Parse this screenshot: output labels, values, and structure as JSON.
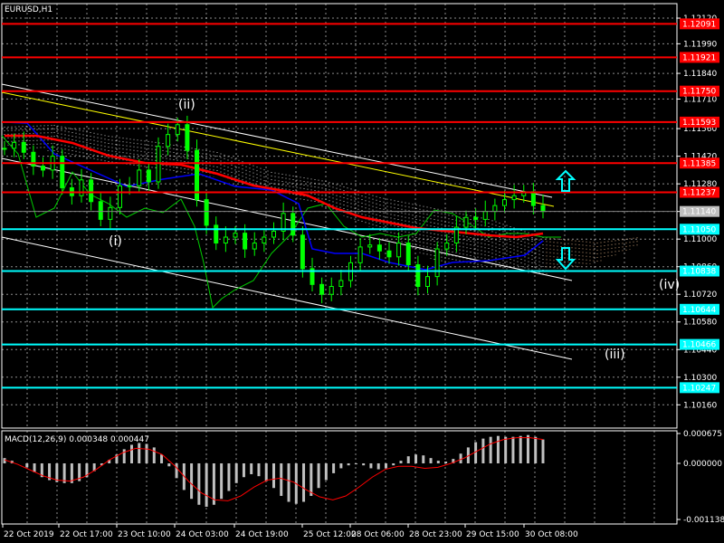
{
  "chart_data": {
    "type": "candlestick",
    "title": "EURUSD,H1",
    "colors": {
      "background": "#000000",
      "grid": "#ffffff",
      "candle": "#00ff00",
      "resistance": "#ff0000",
      "support": "#00ffff",
      "ma": "#ff0000",
      "macd_hist": "#c0c0c0",
      "macd_signal": "#ff0000",
      "arrow": "#00ffff",
      "label_red_bg": "#ff0000",
      "label_cyan_bg": "#00ffff",
      "label_current_bg": "#c0c0c0"
    },
    "y_range": [
      1.10166,
      1.12166
    ],
    "y_ticks": [
      "1.12120",
      "1.11990",
      "1.11840",
      "1.11710",
      "1.11560",
      "1.11420",
      "1.11280",
      "1.11140",
      "1.11000",
      "1.10860",
      "1.10720",
      "1.10580",
      "1.10440",
      "1.10300",
      "1.10160"
    ],
    "x_ticks": [
      "22 Oct 2019",
      "22 Oct 17:00",
      "23 Oct 10:00",
      "24 Oct 03:00",
      "24 Oct 19:00",
      "25 Oct 12:00",
      "28 Oct 06:00",
      "28 Oct 23:00",
      "29 Oct 15:00",
      "30 Oct 08:00"
    ],
    "levels": [
      {
        "value": "1.12091",
        "price": 1.12091,
        "kind": "resistance"
      },
      {
        "value": "1.11921",
        "price": 1.11921,
        "kind": "resistance"
      },
      {
        "value": "1.11750",
        "price": 1.1175,
        "kind": "resistance"
      },
      {
        "value": "1.11593",
        "price": 1.11593,
        "kind": "resistance"
      },
      {
        "value": "1.11385",
        "price": 1.11385,
        "kind": "resistance"
      },
      {
        "value": "1.11237",
        "price": 1.11237,
        "kind": "resistance"
      },
      {
        "value": "1.11050",
        "price": 1.1105,
        "kind": "support"
      },
      {
        "value": "1.10838",
        "price": 1.10838,
        "kind": "support"
      },
      {
        "value": "1.10644",
        "price": 1.10644,
        "kind": "support"
      },
      {
        "value": "1.10466",
        "price": 1.10466,
        "kind": "support"
      },
      {
        "value": "1.10247",
        "price": 1.10247,
        "kind": "support"
      }
    ],
    "current_price": {
      "value": "1.11140",
      "price": 1.1114
    },
    "close_series": [
      1.1146,
      1.1149,
      1.1144,
      1.1137,
      1.1135,
      1.1142,
      1.1126,
      1.1122,
      1.113,
      1.1119,
      1.111,
      1.1116,
      1.1127,
      1.1127,
      1.1135,
      1.1129,
      1.1147,
      1.1153,
      1.1158,
      1.1145,
      1.112,
      1.1107,
      1.1098,
      1.1101,
      1.1103,
      1.1095,
      1.1098,
      1.1101,
      1.1104,
      1.1113,
      1.1102,
      1.1085,
      1.1077,
      1.1072,
      1.1076,
      1.1079,
      1.1088,
      1.1096,
      1.1097,
      1.1094,
      1.1091,
      1.1098,
      1.1087,
      1.1076,
      1.1081,
      1.1095,
      1.1098,
      1.1106,
      1.1111,
      1.111,
      1.1114,
      1.1117,
      1.112,
      1.1122,
      1.1124,
      1.1117,
      1.1114
    ],
    "wave_labels": [
      "(ii)",
      "(i)",
      "(iv)",
      "(iii)"
    ],
    "macd": {
      "label": "MACD(12,26,9) 0.000348 0.000447",
      "y_ticks": [
        "0.000675",
        "0.000000",
        "-0.001138"
      ],
      "range": [
        -0.001138,
        0.000675
      ],
      "histogram": [
        0.00012,
        6e-05,
        0.0,
        -8e-05,
        -0.00018,
        -0.00028,
        -0.00034,
        -0.00038,
        -0.0004,
        -0.0004,
        -0.00036,
        -0.00028,
        -0.00016,
        -4e-05,
        8e-05,
        0.0002,
        0.00032,
        0.00042,
        0.00046,
        0.00044,
        0.00036,
        0.0002,
        -6e-05,
        -0.0003,
        -0.00054,
        -0.00072,
        -0.00084,
        -0.00088,
        -0.00084,
        -0.00072,
        -0.00056,
        -0.0004,
        -0.00028,
        -0.00022,
        -0.00026,
        -0.00036,
        -0.0005,
        -0.00066,
        -0.00078,
        -0.00082,
        -0.00078,
        -0.00066,
        -0.0005,
        -0.00034,
        -0.0002,
        -0.0001,
        -4e-05,
        -2e-05,
        -4e-05,
        -0.0001,
        -0.00012,
        -0.0001,
        -4e-05,
        6e-05,
        0.00016,
        0.0002,
        0.00018,
        0.00012,
        6e-05,
        4e-05,
        0.0001,
        0.00022,
        0.00036,
        0.00048,
        0.00056,
        0.0006,
        0.00062,
        0.0006,
        0.0006,
        0.00062,
        0.00064,
        0.0006,
        0.00054
      ],
      "signal": [
        8e-05,
        -2e-05,
        -0.00014,
        -0.00026,
        -0.00034,
        -0.00036,
        -0.00028,
        -0.00012,
        8e-05,
        0.00024,
        0.00034,
        0.00032,
        0.0002,
        -6e-05,
        -0.00036,
        -0.0006,
        -0.00074,
        -0.00076,
        -0.00066,
        -0.00048,
        -0.00034,
        -0.0003,
        -0.00038,
        -0.00054,
        -0.00068,
        -0.00074,
        -0.00066,
        -0.00048,
        -0.00028,
        -0.00012,
        -6e-05,
        -6e-05,
        -0.0001,
        -8e-05,
        0.0,
        0.00012,
        0.00028,
        0.00044,
        0.00054,
        0.00058,
        0.00058,
        0.00054
      ]
    }
  }
}
